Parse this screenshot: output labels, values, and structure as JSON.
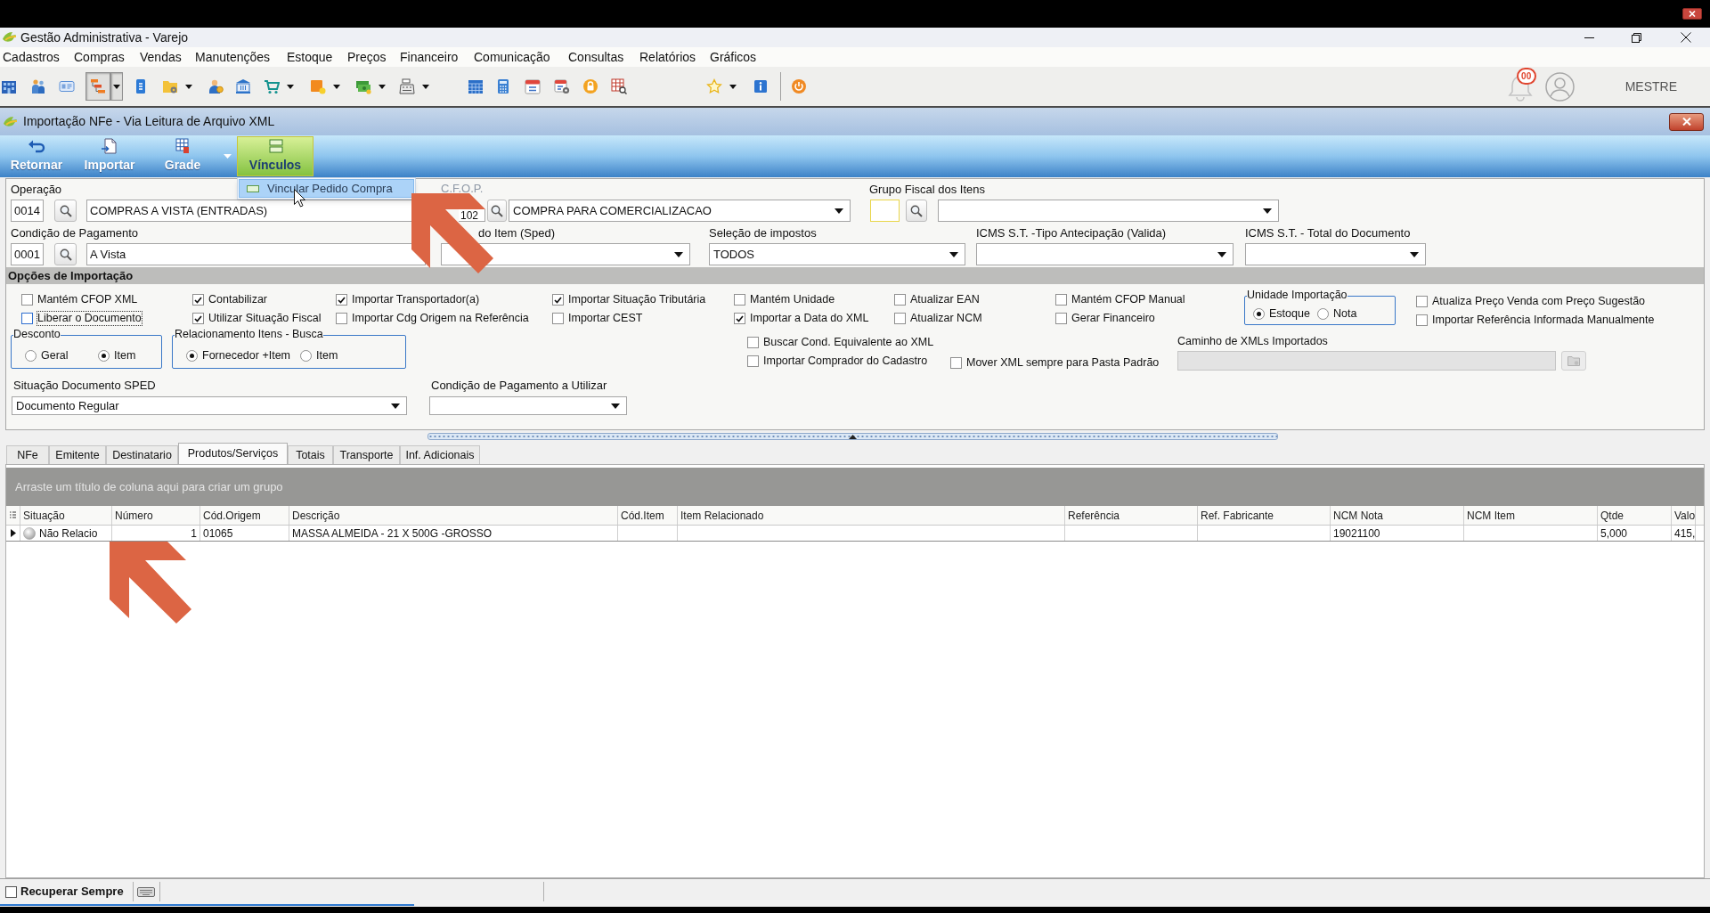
{
  "window": {
    "title": "Gestão Administrativa - Varejo"
  },
  "menu": [
    "Cadastros",
    "Compras",
    "Vendas",
    "Manutenções",
    "Estoque",
    "Preços",
    "Financeiro",
    "Comunicação",
    "Consultas",
    "Relatórios",
    "Gráficos"
  ],
  "toolbar": {
    "buttons": [
      {
        "selected": false,
        "dropdown": false
      },
      {
        "selected": false,
        "dropdown": false
      },
      {
        "selected": false,
        "dropdown": false
      },
      {
        "selected": true,
        "dropdown": true
      },
      {
        "selected": false,
        "dropdown": false
      },
      {
        "selected": false,
        "dropdown": true
      },
      {
        "selected": false,
        "dropdown": false
      },
      {
        "selected": false,
        "dropdown": false
      },
      {
        "selected": false,
        "dropdown": true
      },
      {
        "selected": false,
        "dropdown": true
      },
      {
        "selected": false,
        "dropdown": true
      },
      {
        "selected": false,
        "dropdown": true
      },
      {
        "selected": false,
        "dropdown": false
      },
      {
        "selected": false,
        "dropdown": false
      },
      {
        "selected": false,
        "dropdown": false
      },
      {
        "selected": false,
        "dropdown": false
      },
      {
        "selected": false,
        "dropdown": false
      },
      {
        "selected": false,
        "dropdown": false
      },
      {
        "selected": false,
        "dropdown": true
      },
      {
        "selected": false,
        "dropdown": false
      },
      {
        "selected": false,
        "dropdown": false
      }
    ],
    "notifications": "00",
    "user": "MESTRE"
  },
  "child_window": {
    "title": "Importação NFe - Via Leitura de Arquivo XML"
  },
  "ribbon": [
    {
      "label": "Retornar",
      "selected": false,
      "dropdown": false
    },
    {
      "label": "Importar",
      "selected": false,
      "dropdown": false
    },
    {
      "label": "Grade",
      "selected": false,
      "dropdown": true
    },
    {
      "label": "Vínculos",
      "selected": true,
      "dropdown": false
    }
  ],
  "ribbon_menu": [
    {
      "label": "Vincular Pedido Compra",
      "selected": true
    }
  ],
  "header": {
    "operacao": {
      "label": "Operação",
      "code": "0014",
      "description": "COMPRAS A VISTA (ENTRADAS)"
    },
    "cfop": {
      "label": "C.F.O.P.",
      "code": "102",
      "description": "COMPRA PARA COMERCIALIZACAO"
    },
    "grupo_fiscal": {
      "label": "Grupo Fiscal dos Itens"
    },
    "condicao_pagamento": {
      "label": "Condição de Pagamento",
      "code": "0001",
      "description": "A Vista"
    },
    "tipo_item": {
      "label": "do Item (Sped)"
    },
    "selecao_impostos": {
      "label": "Seleção de impostos",
      "value": "TODOS"
    },
    "icms_st_antecipacao": {
      "label": "ICMS S.T. -Tipo Antecipação (Valida)"
    },
    "icms_st_total": {
      "label": "ICMS S.T. - Total do Documento"
    }
  },
  "import_options": {
    "title": "Opções de Importação",
    "row_1": [
      {
        "kind": "checks",
        "items": [
          {
            "label": "Mantém CFOP XML",
            "checked": false,
            "focused": false
          },
          {
            "label": "Liberar o Documento",
            "checked": false,
            "focused": true
          }
        ]
      },
      {
        "kind": "checks",
        "items": [
          {
            "label": "Contabilizar",
            "checked": true,
            "focused": false
          },
          {
            "label": "Utilizar Situação Fiscal",
            "checked": true,
            "focused": false
          }
        ]
      },
      {
        "kind": "checks",
        "items": [
          {
            "label": "Importar Transportador(a)",
            "checked": true,
            "focused": false
          },
          {
            "label": "Importar Cdg Origem na Referência",
            "checked": false,
            "focused": false
          }
        ]
      },
      {
        "kind": "checks",
        "items": [
          {
            "label": "Importar Situação Tributária",
            "checked": true,
            "focused": false
          },
          {
            "label": "Importar CEST",
            "checked": false,
            "focused": false
          }
        ]
      },
      {
        "kind": "checks",
        "items": [
          {
            "label": "Mantém Unidade",
            "checked": false,
            "focused": false
          },
          {
            "label": "Importar a Data do XML",
            "checked": true,
            "focused": false
          }
        ]
      },
      {
        "kind": "checks",
        "items": [
          {
            "label": "Atualizar EAN",
            "checked": false,
            "focused": false
          },
          {
            "label": "Atualizar NCM",
            "checked": false,
            "focused": false
          }
        ]
      },
      {
        "kind": "checks",
        "items": [
          {
            "label": "Mantém CFOP Manual",
            "checked": false,
            "focused": false
          },
          {
            "label": "Gerar Financeiro",
            "checked": false,
            "focused": false
          }
        ]
      },
      {
        "kind": "radio_group",
        "title": "Unidade Importação",
        "options": [
          {
            "label": "Estoque",
            "selected": true
          },
          {
            "label": "Nota",
            "selected": false
          }
        ]
      },
      {
        "kind": "checks",
        "items": [
          {
            "label": "Atualiza Preço Venda com Preço Sugestão",
            "checked": false,
            "focused": false
          },
          {
            "label": "Importar Referência Informada Manualmente",
            "checked": false,
            "focused": false
          }
        ]
      }
    ],
    "row_2": [
      {
        "kind": "radio_group",
        "title": "Desconto",
        "options": [
          {
            "label": "Geral",
            "selected": false
          },
          {
            "label": "Item",
            "selected": true
          }
        ]
      },
      {
        "kind": "radio_group",
        "title": "Relacionamento Itens - Busca",
        "options": [
          {
            "label": "Fornecedor +Item",
            "selected": true
          },
          {
            "label": "Item",
            "selected": false
          }
        ]
      },
      {
        "kind": "checks",
        "items": [
          {
            "label": "Buscar Cond. Equivalente ao XML",
            "checked": false,
            "focused": false
          },
          {
            "label": "Importar Comprador do Cadastro",
            "checked": false,
            "focused": false
          }
        ]
      },
      {
        "kind": "checks",
        "items": [
          {
            "label": "Mover XML sempre para Pasta Padrão",
            "checked": false,
            "focused": false
          }
        ]
      },
      {
        "kind": "path_field",
        "label": "Caminho de XMLs Importados"
      }
    ]
  },
  "sped": {
    "label": "Situação Documento SPED",
    "value": "Documento Regular"
  },
  "payment_to_use": {
    "label": "Condição de Pagamento a Utilizar"
  },
  "tabs": [
    {
      "label": "NFe",
      "selected": false
    },
    {
      "label": "Emitente",
      "selected": false
    },
    {
      "label": "Destinatario",
      "selected": false
    },
    {
      "label": "Produtos/Serviços",
      "selected": true
    },
    {
      "label": "Totais",
      "selected": false
    },
    {
      "label": "Transporte",
      "selected": false
    },
    {
      "label": "Inf. Adicionais",
      "selected": false
    }
  ],
  "grid": {
    "group_hint": "Arraste um título de coluna aqui para criar um grupo",
    "columns": [
      "Situação",
      "Número",
      "Cód.Origem",
      "Descrição",
      "Cód.Item",
      "Item Relacionado",
      "Referência",
      "Ref. Fabricante",
      "NCM Nota",
      "NCM Item",
      "Qtde",
      "Valo"
    ],
    "rows": [
      {
        "current": true,
        "cells": [
          "Não Relacio",
          "1",
          "01065",
          "MASSA ALMEIDA - 21 X 500G -GROSSO",
          null,
          null,
          null,
          null,
          "19021100",
          null,
          "5,000",
          "415,"
        ]
      }
    ]
  },
  "status_bar": {
    "label": "Recuperar Sempre",
    "checked": false
  }
}
